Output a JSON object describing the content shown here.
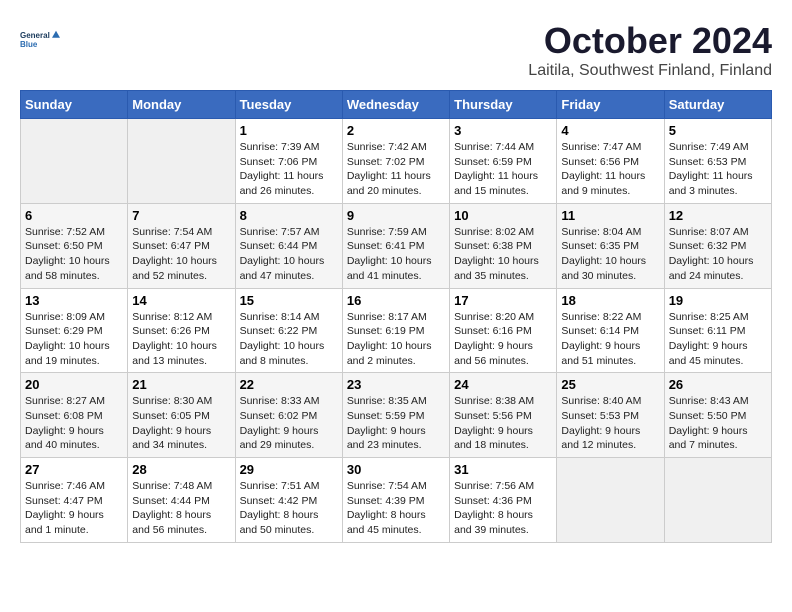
{
  "header": {
    "logo_line1": "General",
    "logo_line2": "Blue",
    "month": "October 2024",
    "location": "Laitila, Southwest Finland, Finland"
  },
  "days_of_week": [
    "Sunday",
    "Monday",
    "Tuesday",
    "Wednesday",
    "Thursday",
    "Friday",
    "Saturday"
  ],
  "weeks": [
    [
      {
        "day": "",
        "text": ""
      },
      {
        "day": "",
        "text": ""
      },
      {
        "day": "1",
        "text": "Sunrise: 7:39 AM\nSunset: 7:06 PM\nDaylight: 11 hours and 26 minutes."
      },
      {
        "day": "2",
        "text": "Sunrise: 7:42 AM\nSunset: 7:02 PM\nDaylight: 11 hours and 20 minutes."
      },
      {
        "day": "3",
        "text": "Sunrise: 7:44 AM\nSunset: 6:59 PM\nDaylight: 11 hours and 15 minutes."
      },
      {
        "day": "4",
        "text": "Sunrise: 7:47 AM\nSunset: 6:56 PM\nDaylight: 11 hours and 9 minutes."
      },
      {
        "day": "5",
        "text": "Sunrise: 7:49 AM\nSunset: 6:53 PM\nDaylight: 11 hours and 3 minutes."
      }
    ],
    [
      {
        "day": "6",
        "text": "Sunrise: 7:52 AM\nSunset: 6:50 PM\nDaylight: 10 hours and 58 minutes."
      },
      {
        "day": "7",
        "text": "Sunrise: 7:54 AM\nSunset: 6:47 PM\nDaylight: 10 hours and 52 minutes."
      },
      {
        "day": "8",
        "text": "Sunrise: 7:57 AM\nSunset: 6:44 PM\nDaylight: 10 hours and 47 minutes."
      },
      {
        "day": "9",
        "text": "Sunrise: 7:59 AM\nSunset: 6:41 PM\nDaylight: 10 hours and 41 minutes."
      },
      {
        "day": "10",
        "text": "Sunrise: 8:02 AM\nSunset: 6:38 PM\nDaylight: 10 hours and 35 minutes."
      },
      {
        "day": "11",
        "text": "Sunrise: 8:04 AM\nSunset: 6:35 PM\nDaylight: 10 hours and 30 minutes."
      },
      {
        "day": "12",
        "text": "Sunrise: 8:07 AM\nSunset: 6:32 PM\nDaylight: 10 hours and 24 minutes."
      }
    ],
    [
      {
        "day": "13",
        "text": "Sunrise: 8:09 AM\nSunset: 6:29 PM\nDaylight: 10 hours and 19 minutes."
      },
      {
        "day": "14",
        "text": "Sunrise: 8:12 AM\nSunset: 6:26 PM\nDaylight: 10 hours and 13 minutes."
      },
      {
        "day": "15",
        "text": "Sunrise: 8:14 AM\nSunset: 6:22 PM\nDaylight: 10 hours and 8 minutes."
      },
      {
        "day": "16",
        "text": "Sunrise: 8:17 AM\nSunset: 6:19 PM\nDaylight: 10 hours and 2 minutes."
      },
      {
        "day": "17",
        "text": "Sunrise: 8:20 AM\nSunset: 6:16 PM\nDaylight: 9 hours and 56 minutes."
      },
      {
        "day": "18",
        "text": "Sunrise: 8:22 AM\nSunset: 6:14 PM\nDaylight: 9 hours and 51 minutes."
      },
      {
        "day": "19",
        "text": "Sunrise: 8:25 AM\nSunset: 6:11 PM\nDaylight: 9 hours and 45 minutes."
      }
    ],
    [
      {
        "day": "20",
        "text": "Sunrise: 8:27 AM\nSunset: 6:08 PM\nDaylight: 9 hours and 40 minutes."
      },
      {
        "day": "21",
        "text": "Sunrise: 8:30 AM\nSunset: 6:05 PM\nDaylight: 9 hours and 34 minutes."
      },
      {
        "day": "22",
        "text": "Sunrise: 8:33 AM\nSunset: 6:02 PM\nDaylight: 9 hours and 29 minutes."
      },
      {
        "day": "23",
        "text": "Sunrise: 8:35 AM\nSunset: 5:59 PM\nDaylight: 9 hours and 23 minutes."
      },
      {
        "day": "24",
        "text": "Sunrise: 8:38 AM\nSunset: 5:56 PM\nDaylight: 9 hours and 18 minutes."
      },
      {
        "day": "25",
        "text": "Sunrise: 8:40 AM\nSunset: 5:53 PM\nDaylight: 9 hours and 12 minutes."
      },
      {
        "day": "26",
        "text": "Sunrise: 8:43 AM\nSunset: 5:50 PM\nDaylight: 9 hours and 7 minutes."
      }
    ],
    [
      {
        "day": "27",
        "text": "Sunrise: 7:46 AM\nSunset: 4:47 PM\nDaylight: 9 hours and 1 minute."
      },
      {
        "day": "28",
        "text": "Sunrise: 7:48 AM\nSunset: 4:44 PM\nDaylight: 8 hours and 56 minutes."
      },
      {
        "day": "29",
        "text": "Sunrise: 7:51 AM\nSunset: 4:42 PM\nDaylight: 8 hours and 50 minutes."
      },
      {
        "day": "30",
        "text": "Sunrise: 7:54 AM\nSunset: 4:39 PM\nDaylight: 8 hours and 45 minutes."
      },
      {
        "day": "31",
        "text": "Sunrise: 7:56 AM\nSunset: 4:36 PM\nDaylight: 8 hours and 39 minutes."
      },
      {
        "day": "",
        "text": ""
      },
      {
        "day": "",
        "text": ""
      }
    ]
  ]
}
